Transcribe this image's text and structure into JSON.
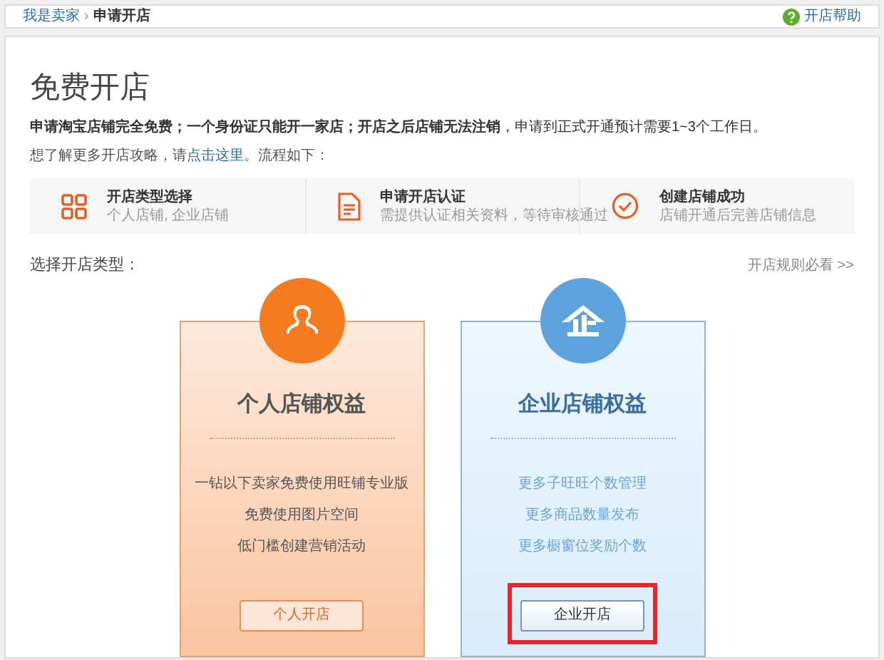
{
  "breadcrumb": {
    "items": [
      "我是卖家",
      "申请开店"
    ],
    "separator": "›"
  },
  "help_link": "开店帮助",
  "title": "免费开店",
  "notice": "**申请淘宝店铺完全免费；一个身份证只能开一家店；开店之后店铺无法注销**，申请到正式开通预计需要1~3个工作日。",
  "guide": {
    "before": "想了解更多开店攻略，请",
    "link": "点击这里",
    "after": "。流程如下："
  },
  "steps": [
    {
      "kind": "grid",
      "title": "开店类型选择",
      "subtitle": "个人店铺, 企业店铺"
    },
    {
      "kind": "document",
      "title": "申请开店认证",
      "subtitle": "需提供认证相关资料，等待审核通过"
    },
    {
      "kind": "check",
      "title": "创建店铺成功",
      "subtitle": "店铺开通后完善店铺信息"
    }
  ],
  "choose_label": "选择开店类型：",
  "rules_link": "开店规则必看 >>",
  "cards": [
    {
      "kind": "personal",
      "title": "个人店铺权益",
      "benefits": [
        "一钻以下卖家免费使用旺铺专业版",
        "免费使用图片空间",
        "低门槛创建营销活动"
      ],
      "button": "个人开店",
      "highlighted": false
    },
    {
      "kind": "enterprise",
      "title": "企业店铺权益",
      "benefits": [
        "更多子旺旺个数管理",
        "更多商品数量发布",
        "更多橱窗位奖励个数"
      ],
      "button": "企业开店",
      "highlighted": true
    }
  ]
}
